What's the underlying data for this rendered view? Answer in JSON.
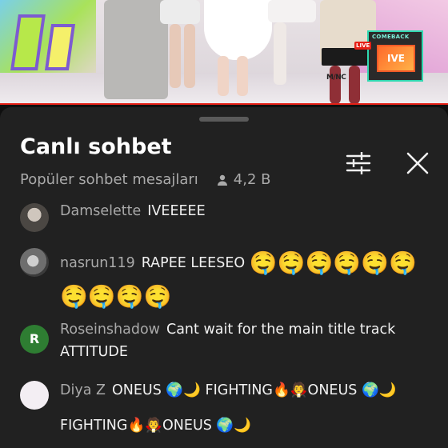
{
  "video": {
    "corner_badge_top": "COMEBACK",
    "corner_badge_live": "LIVE",
    "corner_badge_name": "IVE",
    "channel_logo": "M/NC"
  },
  "chat": {
    "title": "Canlı sohbet",
    "subtitle": "Popüler sohbet mesajları",
    "viewer_count": "4,2 B",
    "viewer_icon": "person-icon",
    "filter_icon": "sliders-icon",
    "close_icon": "close-icon"
  },
  "messages": [
    {
      "author": "Damselette",
      "text": "IVEEEEE",
      "emoji": ""
    },
    {
      "author": "nasrun119",
      "text": "RAPEE LEESEO",
      "emoji": "🤤🤤🤤🤤🤤🤤🤤🤤🤤🤤"
    },
    {
      "author": "Roseinshadow",
      "text": "Cant wait for the main title track ATTITUDE",
      "avatar_letter": "R",
      "emoji": ""
    },
    {
      "author": "Diya Z",
      "text": "ONEUS 🌍🌙 FIGHTING🔥🧛ONEUS 🌍🌙 FIGHTING🔥🧛ONEUS 🌍🌙",
      "emoji": ""
    }
  ],
  "colors": {
    "sheet_bg": "#212121",
    "author": "#aaaaaa",
    "progress": "#e62117",
    "avatar_r": "#2e7d32"
  }
}
